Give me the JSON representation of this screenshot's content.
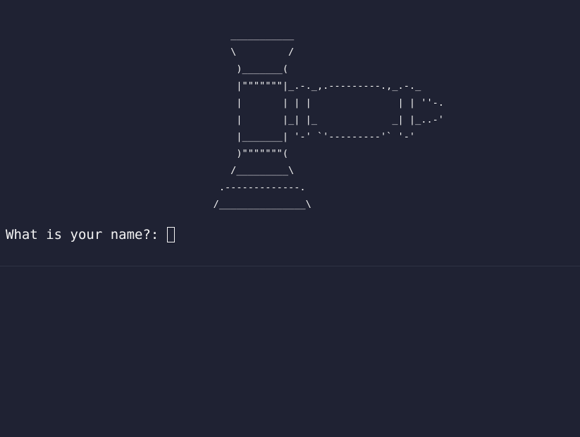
{
  "terminal": {
    "ascii_art": "                                       ___________\n                                       \\         /\n                                        )_______(\n                                        |\"\"\"\"\"\"\"|_.-._,.---------.,_.-._\n                                        |       | | |               | | ''-.\n                                        |       |_| |_             _| |_..-'\n                                        |_______| '-' `'---------'` '-'\n                                        )\"\"\"\"\"\"\"(\n                                       /_________\\\n                                     .-------------.\n                                    /_______________\\",
    "prompt_text": "What is your name?: ",
    "input_value": ""
  }
}
